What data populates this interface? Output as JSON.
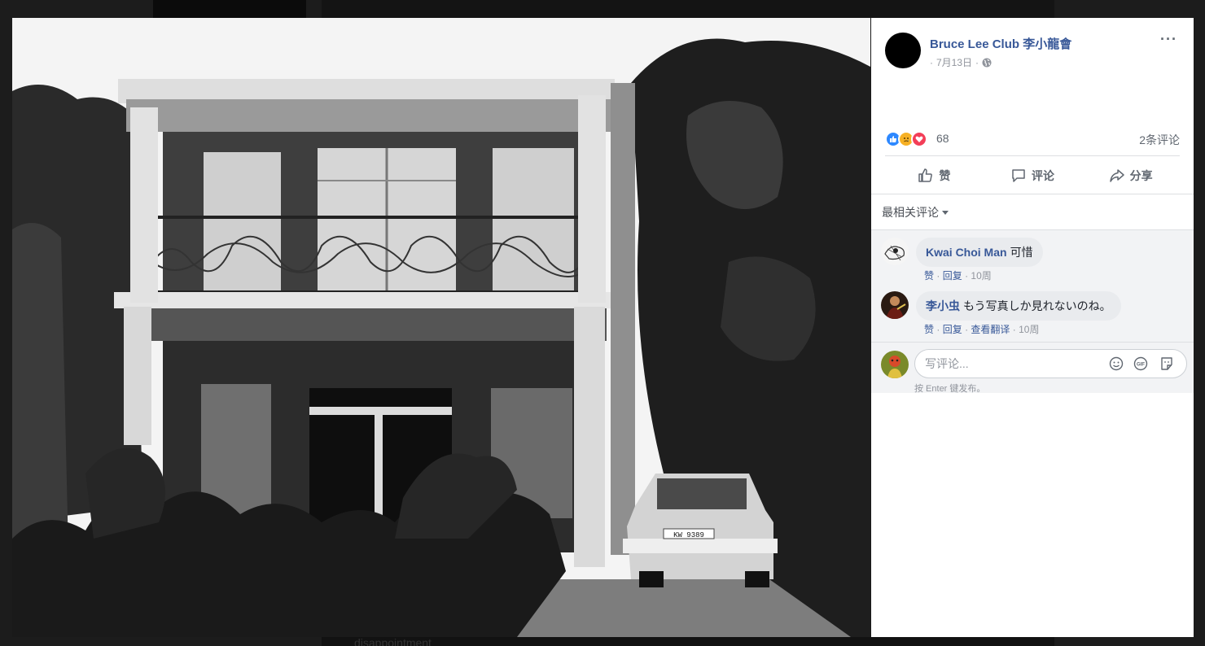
{
  "backdrop": {
    "bottom_text": "disappointment"
  },
  "photo": {
    "alt": "Two-storey house with balcony, car parked in driveway, black and white photograph",
    "plate": "KW 9389"
  },
  "post": {
    "page_name": "Bruce Lee Club 李小龍會",
    "date": "7月13日",
    "separator": "·",
    "more": "···",
    "reaction_count": "68",
    "comment_count": "2条评论"
  },
  "actions": {
    "like": "赞",
    "comment": "评论",
    "share": "分享"
  },
  "sort": {
    "label": "最相关评论"
  },
  "comments": [
    {
      "author": "Kwai Choi Man",
      "text": "可惜",
      "links": [
        "赞",
        "回复"
      ],
      "time": "10周"
    },
    {
      "author": "李小虫",
      "text": "もう写真しか見れないのね。",
      "links": [
        "赞",
        "回复",
        "查看翻译"
      ],
      "time": "10周"
    }
  ],
  "composer": {
    "placeholder": "写评论...",
    "hint": "按 Enter 键发布。"
  },
  "colors": {
    "link": "#385898",
    "muted": "#90949c",
    "like": "#2d88ff",
    "love": "#f33e58",
    "sad": "#f7b125"
  }
}
